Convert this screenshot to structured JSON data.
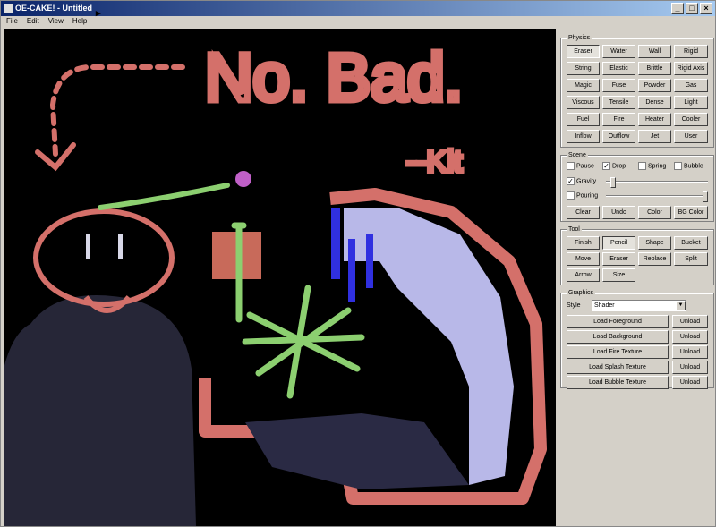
{
  "window": {
    "title": "OE-CAKE! - Untitled",
    "controls": [
      "_",
      "□",
      "×"
    ]
  },
  "menu": [
    "File",
    "Edit",
    "View",
    "Help"
  ],
  "canvas": {
    "drawn_text": [
      "No. Bad.",
      "--Kit"
    ]
  },
  "physics": {
    "title": "Physics",
    "buttons": [
      "Eraser",
      "Water",
      "Wall",
      "Rigid",
      "String",
      "Elastic",
      "Brittle",
      "Rigid Axis",
      "Magic",
      "Fuse",
      "Powder",
      "Gas",
      "Viscous",
      "Tensile",
      "Dense",
      "Light",
      "Fuel",
      "Fire",
      "Heater",
      "Cooler",
      "Inflow",
      "Outflow",
      "Jet",
      "User"
    ]
  },
  "scene": {
    "title": "Scene",
    "checkboxes": [
      {
        "label": "Pause",
        "checked": false
      },
      {
        "label": "Drop",
        "checked": true
      },
      {
        "label": "Spring",
        "checked": false
      },
      {
        "label": "Bubble",
        "checked": false
      }
    ],
    "gravity": {
      "label": "Gravity",
      "checked": true,
      "level": 0.05
    },
    "pouring": {
      "label": "Pouring",
      "checked": false,
      "level": 1.0
    },
    "buttons": [
      "Clear",
      "Undo",
      "Color",
      "BG Color"
    ]
  },
  "tool": {
    "title": "Tool",
    "buttons": [
      "Finish",
      "Pencil",
      "Shape",
      "Bucket",
      "Move",
      "Eraser",
      "Replace",
      "Split",
      "Arrow",
      "Size"
    ],
    "active": "Pencil"
  },
  "graphics": {
    "title": "Graphics",
    "style_label": "Style",
    "style_value": "Shader",
    "loads": [
      {
        "label": "Load Foreground",
        "unload": "Unload"
      },
      {
        "label": "Load Background",
        "unload": "Unload"
      },
      {
        "label": "Load Fire Texture",
        "unload": "Unload"
      },
      {
        "label": "Load Splash Texture",
        "unload": "Unload"
      },
      {
        "label": "Load Bubble Texture",
        "unload": "Unload"
      }
    ]
  }
}
